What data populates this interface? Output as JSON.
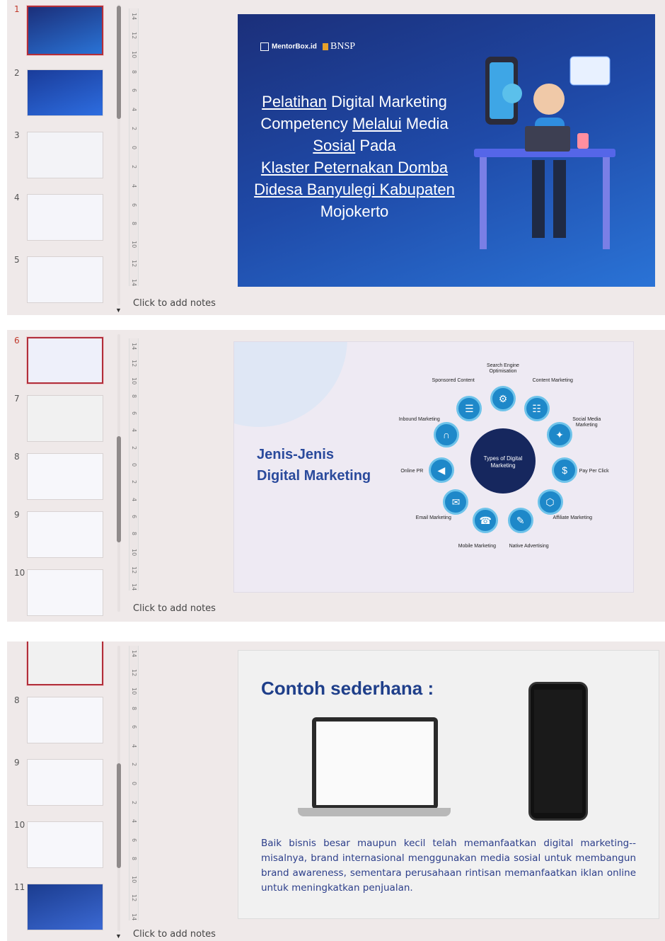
{
  "panels": [
    {
      "thumbnails": [
        {
          "num": "1",
          "active": true
        },
        {
          "num": "2"
        },
        {
          "num": "3"
        },
        {
          "num": "4"
        },
        {
          "num": "5"
        }
      ],
      "ruler_ticks": [
        "14",
        "12",
        "10",
        "8",
        "6",
        "4",
        "2",
        "0",
        "2",
        "4",
        "6",
        "8",
        "10",
        "12",
        "14"
      ],
      "notes": "Click to add notes",
      "slide": {
        "logo_mentorbox": "MentorBox.id",
        "logo_bnsp": "BNSP",
        "title_parts": [
          {
            "text": "Pelatihan",
            "u": true
          },
          {
            "text": " Digital Marketing",
            "u": false
          },
          {
            "text": "Competency ",
            "u": false
          },
          {
            "text": "Melalui",
            "u": true
          },
          {
            "text": " Media",
            "u": false
          },
          {
            "text": "Sosial",
            "u": true
          },
          {
            "text": " Pada",
            "u": false
          },
          {
            "text": "Klaster Peternakan Domba",
            "u": true
          },
          {
            "text": "Didesa Banyulegi Kabupaten",
            "u": true
          },
          {
            "text": "Mojokerto",
            "u": false
          }
        ]
      }
    },
    {
      "thumbnails": [
        {
          "num": "6",
          "active": true
        },
        {
          "num": "7"
        },
        {
          "num": "8"
        },
        {
          "num": "9"
        },
        {
          "num": "10"
        }
      ],
      "notes": "Click to add notes",
      "slide": {
        "title_line1": "Jenis-Jenis",
        "title_line2": "Digital Marketing",
        "hub": "Types of Digital Marketing",
        "nodes": [
          {
            "label": "Search Engine Optimisation",
            "icon": "gear-icon"
          },
          {
            "label": "Content Marketing",
            "icon": "document-icon"
          },
          {
            "label": "Social Media Marketing",
            "icon": "share-icon"
          },
          {
            "label": "Pay Per Click",
            "icon": "dollar-icon"
          },
          {
            "label": "Affiliate Marketing",
            "icon": "network-icon"
          },
          {
            "label": "Native Advertising",
            "icon": "edit-icon"
          },
          {
            "label": "Mobile Marketing",
            "icon": "phone-icon"
          },
          {
            "label": "Email Marketing",
            "icon": "email-icon"
          },
          {
            "label": "Online PR",
            "icon": "megaphone-icon"
          },
          {
            "label": "Inbound Marketing",
            "icon": "magnet-icon"
          },
          {
            "label": "Sponsored Content",
            "icon": "list-icon"
          }
        ]
      }
    },
    {
      "thumbnails": [
        {
          "num": "",
          "active": true
        },
        {
          "num": "8"
        },
        {
          "num": "9"
        },
        {
          "num": "10"
        },
        {
          "num": "11"
        }
      ],
      "notes": "Click to add notes",
      "slide": {
        "title": "Contoh sederhana :",
        "body": "Baik bisnis besar maupun kecil telah memanfaatkan digital marketing--misalnya, brand internasional menggunakan media sosial untuk membangun brand awareness, sementara perusahaan rintisan memanfaatkan iklan online untuk meningkatkan penjualan."
      }
    }
  ]
}
